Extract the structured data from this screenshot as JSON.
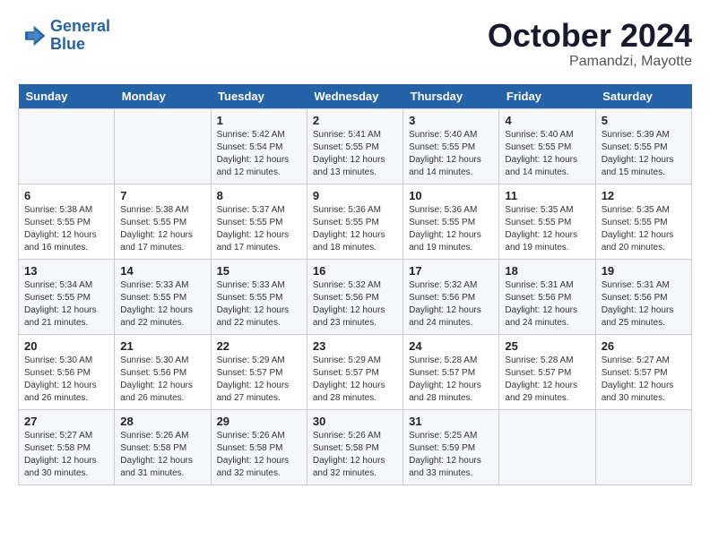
{
  "header": {
    "logo_line1": "General",
    "logo_line2": "Blue",
    "month": "October 2024",
    "location": "Pamandzi, Mayotte"
  },
  "weekdays": [
    "Sunday",
    "Monday",
    "Tuesday",
    "Wednesday",
    "Thursday",
    "Friday",
    "Saturday"
  ],
  "weeks": [
    [
      {
        "day": "",
        "info": ""
      },
      {
        "day": "",
        "info": ""
      },
      {
        "day": "1",
        "info": "Sunrise: 5:42 AM\nSunset: 5:54 PM\nDaylight: 12 hours\nand 12 minutes."
      },
      {
        "day": "2",
        "info": "Sunrise: 5:41 AM\nSunset: 5:55 PM\nDaylight: 12 hours\nand 13 minutes."
      },
      {
        "day": "3",
        "info": "Sunrise: 5:40 AM\nSunset: 5:55 PM\nDaylight: 12 hours\nand 14 minutes."
      },
      {
        "day": "4",
        "info": "Sunrise: 5:40 AM\nSunset: 5:55 PM\nDaylight: 12 hours\nand 14 minutes."
      },
      {
        "day": "5",
        "info": "Sunrise: 5:39 AM\nSunset: 5:55 PM\nDaylight: 12 hours\nand 15 minutes."
      }
    ],
    [
      {
        "day": "6",
        "info": "Sunrise: 5:38 AM\nSunset: 5:55 PM\nDaylight: 12 hours\nand 16 minutes."
      },
      {
        "day": "7",
        "info": "Sunrise: 5:38 AM\nSunset: 5:55 PM\nDaylight: 12 hours\nand 17 minutes."
      },
      {
        "day": "8",
        "info": "Sunrise: 5:37 AM\nSunset: 5:55 PM\nDaylight: 12 hours\nand 17 minutes."
      },
      {
        "day": "9",
        "info": "Sunrise: 5:36 AM\nSunset: 5:55 PM\nDaylight: 12 hours\nand 18 minutes."
      },
      {
        "day": "10",
        "info": "Sunrise: 5:36 AM\nSunset: 5:55 PM\nDaylight: 12 hours\nand 19 minutes."
      },
      {
        "day": "11",
        "info": "Sunrise: 5:35 AM\nSunset: 5:55 PM\nDaylight: 12 hours\nand 19 minutes."
      },
      {
        "day": "12",
        "info": "Sunrise: 5:35 AM\nSunset: 5:55 PM\nDaylight: 12 hours\nand 20 minutes."
      }
    ],
    [
      {
        "day": "13",
        "info": "Sunrise: 5:34 AM\nSunset: 5:55 PM\nDaylight: 12 hours\nand 21 minutes."
      },
      {
        "day": "14",
        "info": "Sunrise: 5:33 AM\nSunset: 5:55 PM\nDaylight: 12 hours\nand 22 minutes."
      },
      {
        "day": "15",
        "info": "Sunrise: 5:33 AM\nSunset: 5:55 PM\nDaylight: 12 hours\nand 22 minutes."
      },
      {
        "day": "16",
        "info": "Sunrise: 5:32 AM\nSunset: 5:56 PM\nDaylight: 12 hours\nand 23 minutes."
      },
      {
        "day": "17",
        "info": "Sunrise: 5:32 AM\nSunset: 5:56 PM\nDaylight: 12 hours\nand 24 minutes."
      },
      {
        "day": "18",
        "info": "Sunrise: 5:31 AM\nSunset: 5:56 PM\nDaylight: 12 hours\nand 24 minutes."
      },
      {
        "day": "19",
        "info": "Sunrise: 5:31 AM\nSunset: 5:56 PM\nDaylight: 12 hours\nand 25 minutes."
      }
    ],
    [
      {
        "day": "20",
        "info": "Sunrise: 5:30 AM\nSunset: 5:56 PM\nDaylight: 12 hours\nand 26 minutes."
      },
      {
        "day": "21",
        "info": "Sunrise: 5:30 AM\nSunset: 5:56 PM\nDaylight: 12 hours\nand 26 minutes."
      },
      {
        "day": "22",
        "info": "Sunrise: 5:29 AM\nSunset: 5:57 PM\nDaylight: 12 hours\nand 27 minutes."
      },
      {
        "day": "23",
        "info": "Sunrise: 5:29 AM\nSunset: 5:57 PM\nDaylight: 12 hours\nand 28 minutes."
      },
      {
        "day": "24",
        "info": "Sunrise: 5:28 AM\nSunset: 5:57 PM\nDaylight: 12 hours\nand 28 minutes."
      },
      {
        "day": "25",
        "info": "Sunrise: 5:28 AM\nSunset: 5:57 PM\nDaylight: 12 hours\nand 29 minutes."
      },
      {
        "day": "26",
        "info": "Sunrise: 5:27 AM\nSunset: 5:57 PM\nDaylight: 12 hours\nand 30 minutes."
      }
    ],
    [
      {
        "day": "27",
        "info": "Sunrise: 5:27 AM\nSunset: 5:58 PM\nDaylight: 12 hours\nand 30 minutes."
      },
      {
        "day": "28",
        "info": "Sunrise: 5:26 AM\nSunset: 5:58 PM\nDaylight: 12 hours\nand 31 minutes."
      },
      {
        "day": "29",
        "info": "Sunrise: 5:26 AM\nSunset: 5:58 PM\nDaylight: 12 hours\nand 32 minutes."
      },
      {
        "day": "30",
        "info": "Sunrise: 5:26 AM\nSunset: 5:58 PM\nDaylight: 12 hours\nand 32 minutes."
      },
      {
        "day": "31",
        "info": "Sunrise: 5:25 AM\nSunset: 5:59 PM\nDaylight: 12 hours\nand 33 minutes."
      },
      {
        "day": "",
        "info": ""
      },
      {
        "day": "",
        "info": ""
      }
    ]
  ]
}
